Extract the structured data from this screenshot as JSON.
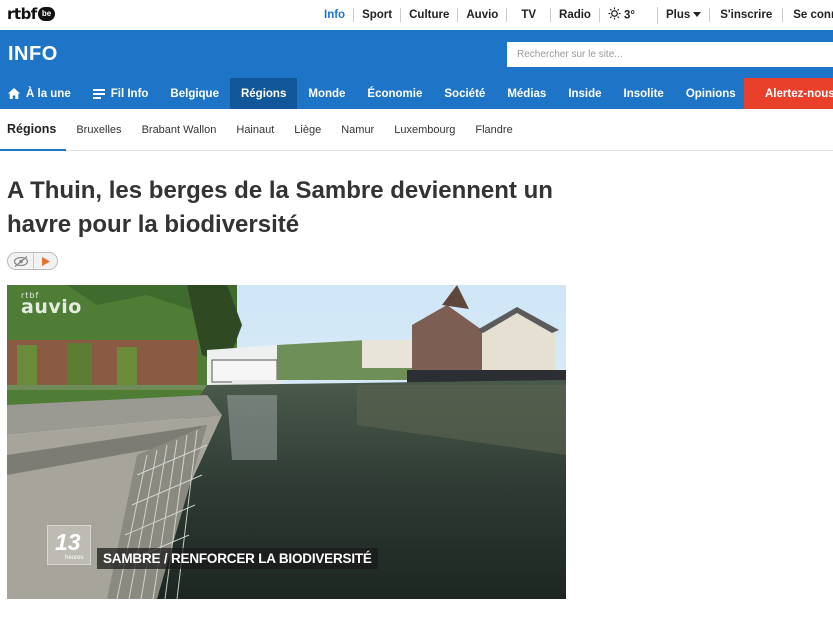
{
  "brand": {
    "logo_text": "rtbf",
    "logo_badge": "be"
  },
  "topnav": {
    "items": [
      "Info",
      "Sport",
      "Culture",
      "Auvio",
      "TV",
      "Radio"
    ],
    "weather": "3°",
    "more": "Plus",
    "signup": "S'inscrire",
    "login": "Se connecter"
  },
  "header": {
    "title": "INFO",
    "search_placeholder": "Rechercher sur le site..."
  },
  "mainnav": {
    "items": [
      "À la une",
      "Fil Info",
      "Belgique",
      "Régions",
      "Monde",
      "Économie",
      "Société",
      "Médias",
      "Inside",
      "Insolite",
      "Opinions"
    ],
    "alert": "Alertez-nous"
  },
  "subnav": {
    "items": [
      "Régions",
      "Bruxelles",
      "Brabant Wallon",
      "Hainaut",
      "Liège",
      "Namur",
      "Luxembourg",
      "Flandre"
    ]
  },
  "article": {
    "headline": "A Thuin, les berges de la Sambre deviennent un havre pour la biodiversité",
    "video": {
      "logo_small": "rtbf",
      "logo_big": "auvio",
      "badge_number": "13",
      "badge_label": "heures",
      "caption_keyword": "SAMBRE",
      "caption_text": " / RENFORCER LA BIODIVERSITÉ"
    }
  },
  "colors": {
    "brand_blue": "#1e75c8",
    "active_blue": "#12579a",
    "alert_red": "#e8402a"
  }
}
